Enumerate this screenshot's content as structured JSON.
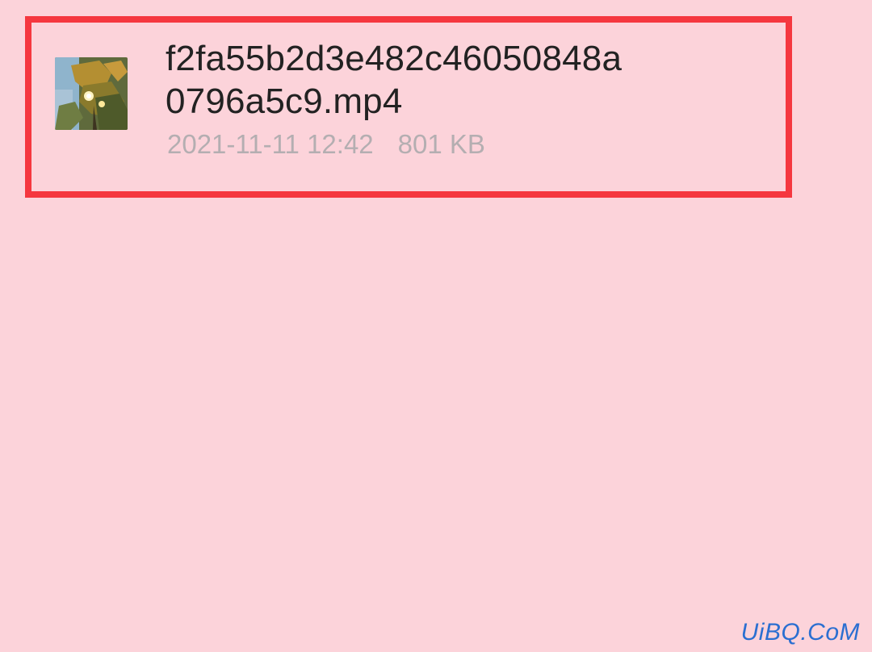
{
  "file": {
    "name_line1": "f2fa55b2d3e482c46050848a",
    "name_line2": "0796a5c9.mp4",
    "date": "2021-11-11 12:42",
    "size": "801 KB",
    "thumbnail_icon": "video-thumbnail-autumn-leaves"
  },
  "watermark": {
    "text": "UiBQ.CoM"
  },
  "colors": {
    "background": "#fcd3da",
    "highlight_border": "#f5373f",
    "name_text": "#222222",
    "meta_text": "#b4aeb1",
    "watermark": "#2b6fd1"
  }
}
